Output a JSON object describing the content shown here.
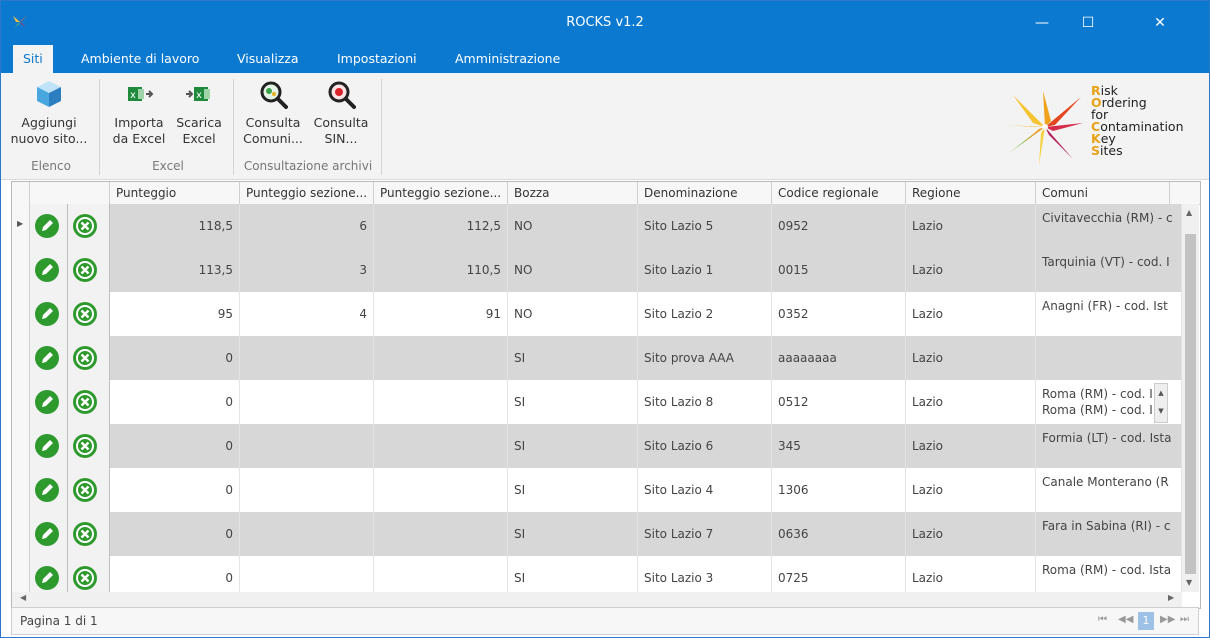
{
  "window": {
    "title": "ROCKS  v1.2",
    "minimize": "—",
    "maximize": "☐",
    "close": "✕"
  },
  "tabs": [
    "Siti",
    "Ambiente di lavoro",
    "Visualizza",
    "Impostazioni",
    "Amministrazione"
  ],
  "ribbon": {
    "buttons": {
      "add": [
        "Aggiungi",
        "nuovo sito..."
      ],
      "import": [
        "Importa",
        "da Excel"
      ],
      "download": [
        "Scarica",
        "Excel"
      ],
      "consult_comuni": [
        "Consulta",
        "Comuni..."
      ],
      "consult_sin": [
        "Consulta",
        "SIN..."
      ]
    },
    "groups": {
      "elenco": "Elenco",
      "excel": "Excel",
      "archivi": "Consultazione archivi"
    }
  },
  "logo": {
    "lines": [
      {
        "cap": "R",
        "rest": "isk"
      },
      {
        "cap": "O",
        "rest": "rdering"
      },
      {
        "cap": "",
        "rest": "for"
      },
      {
        "cap": "C",
        "rest": "ontamination"
      },
      {
        "cap": "K",
        "rest": "ey"
      },
      {
        "cap": "S",
        "rest": "ites"
      }
    ],
    "cap_color": "#e8a217"
  },
  "table": {
    "columns": [
      "Punteggio",
      "Punteggio sezione...",
      "Punteggio sezione...",
      "Bozza",
      "Denominazione",
      "Codice regionale",
      "Regione",
      "Comuni"
    ],
    "rows": [
      {
        "punteggio": "118,5",
        "p1": "6",
        "p2": "112,5",
        "bozza": "NO",
        "denominazione": "Sito Lazio 5",
        "codice": "0952",
        "regione": "Lazio",
        "comuni": [
          "Civitavecchia (RM) - c"
        ]
      },
      {
        "punteggio": "113,5",
        "p1": "3",
        "p2": "110,5",
        "bozza": "NO",
        "denominazione": "Sito Lazio 1",
        "codice": "0015",
        "regione": "Lazio",
        "comuni": [
          "Tarquinia (VT) - cod. I"
        ]
      },
      {
        "punteggio": "95",
        "p1": "4",
        "p2": "91",
        "bozza": "NO",
        "denominazione": "Sito Lazio 2",
        "codice": "0352",
        "regione": "Lazio",
        "comuni": [
          "Anagni (FR) - cod. Ist"
        ]
      },
      {
        "punteggio": "0",
        "p1": "",
        "p2": "",
        "bozza": "SI",
        "denominazione": "Sito prova AAA",
        "codice": "aaaaaaaa",
        "regione": "Lazio",
        "comuni": []
      },
      {
        "punteggio": "0",
        "p1": "",
        "p2": "",
        "bozza": "SI",
        "denominazione": "Sito Lazio 8",
        "codice": "0512",
        "regione": "Lazio",
        "comuni": [
          "Roma (RM) - cod. I",
          "Roma (RM) - cod. I"
        ]
      },
      {
        "punteggio": "0",
        "p1": "",
        "p2": "",
        "bozza": "SI",
        "denominazione": "Sito Lazio 6",
        "codice": "345",
        "regione": "Lazio",
        "comuni": [
          "Formia (LT) - cod. Ista"
        ]
      },
      {
        "punteggio": "0",
        "p1": "",
        "p2": "",
        "bozza": "SI",
        "denominazione": "Sito Lazio 4",
        "codice": "1306",
        "regione": "Lazio",
        "comuni": [
          "Canale Monterano (R"
        ]
      },
      {
        "punteggio": "0",
        "p1": "",
        "p2": "",
        "bozza": "SI",
        "denominazione": "Sito Lazio 7",
        "codice": "0636",
        "regione": "Lazio",
        "comuni": [
          "Fara in Sabina (RI) - c"
        ]
      },
      {
        "punteggio": "0",
        "p1": "",
        "p2": "",
        "bozza": "SI",
        "denominazione": "Sito Lazio 3",
        "codice": "0725",
        "regione": "Lazio",
        "comuni": [
          "Roma (RM) - cod. Ista"
        ]
      }
    ]
  },
  "pager": {
    "label": "Pagina 1 di 1",
    "current_page": "1"
  },
  "colors": {
    "accent": "#0b79d0",
    "action_green": "#2e9a2e",
    "row_gray": "#d7d7d7"
  }
}
